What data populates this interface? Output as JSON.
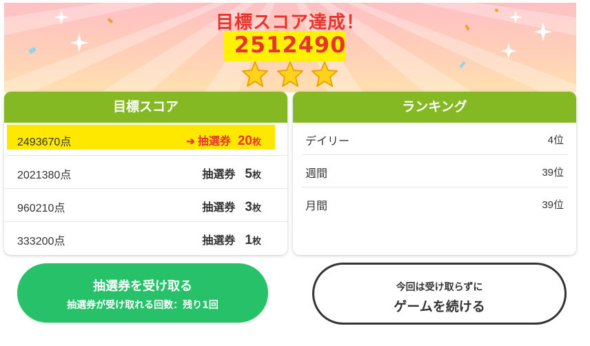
{
  "header": {
    "title": "目標スコア達成！",
    "score": "2512490",
    "stars": 3
  },
  "target_panel": {
    "title": "目標スコア",
    "rows": [
      {
        "points": "2493670点",
        "ticket_label": "抽選券",
        "count": "20",
        "unit": "枚",
        "achieved": true
      },
      {
        "points": "2021380点",
        "ticket_label": "抽選券",
        "count": "5",
        "unit": "枚",
        "achieved": false
      },
      {
        "points": "960210点",
        "ticket_label": "抽選券",
        "count": "3",
        "unit": "枚",
        "achieved": false
      },
      {
        "points": "333200点",
        "ticket_label": "抽選券",
        "count": "1",
        "unit": "枚",
        "achieved": false
      }
    ]
  },
  "ranking_panel": {
    "title": "ランキング",
    "rows": [
      {
        "name": "デイリー",
        "rank": "4位"
      },
      {
        "name": "週間",
        "rank": "39位"
      },
      {
        "name": "月間",
        "rank": "39位"
      }
    ]
  },
  "receive_button": {
    "label": "抽選券を受け取る",
    "sublabel": "抽選券が受け取れる回数：残り1回"
  },
  "continue_button": {
    "sublabel": "今回は受け取らずに",
    "label": "ゲームを続ける"
  },
  "colors": {
    "accent_red": "#e8332e",
    "highlight_yellow": "#ffe800",
    "panel_green": "#84b923",
    "button_green": "#26c169"
  }
}
